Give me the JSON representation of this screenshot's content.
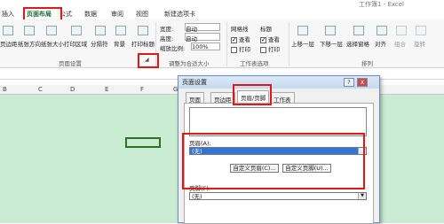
{
  "window": {
    "title": "工作簿1 - Excel"
  },
  "tabs": [
    "插入",
    "页面布局",
    "公式",
    "数据",
    "审阅",
    "视图",
    "新建选项卡"
  ],
  "ribbon": {
    "page_setup": {
      "items": [
        "页边距",
        "纸张方向",
        "纸张大小",
        "打印区域",
        "分隔符",
        "背景",
        "打印标题"
      ],
      "label": "页面设置"
    },
    "scale": {
      "width_label": "宽度:",
      "width_value": "自动",
      "height_label": "高度:",
      "height_value": "自动",
      "zoom_label": "缩放比例:",
      "zoom_value": "100%",
      "label": "调整为合适大小"
    },
    "sheet_options": {
      "gridlines": "网格线",
      "headings": "标题",
      "view": "查看",
      "print": "打印",
      "label": "工作表选项"
    },
    "arrange": {
      "items": [
        "上移一层",
        "下移一层",
        "选择窗格",
        "对齐",
        "组合",
        "旋转"
      ],
      "label": "排列"
    }
  },
  "columns": [
    "B",
    "C",
    "D",
    "E",
    "F",
    "G"
  ],
  "dialog": {
    "title": "页面设置",
    "help": "?",
    "close": "X",
    "tabs": [
      "页面",
      "页边距",
      "页眉/页脚",
      "工作表"
    ],
    "header_label": "页眉(A):",
    "header_value": "(无)",
    "custom_header": "自定义页眉(C)...",
    "custom_footer": "自定义页脚(U)...",
    "footer_label": "页脚(F):",
    "footer_value": "(无)"
  }
}
